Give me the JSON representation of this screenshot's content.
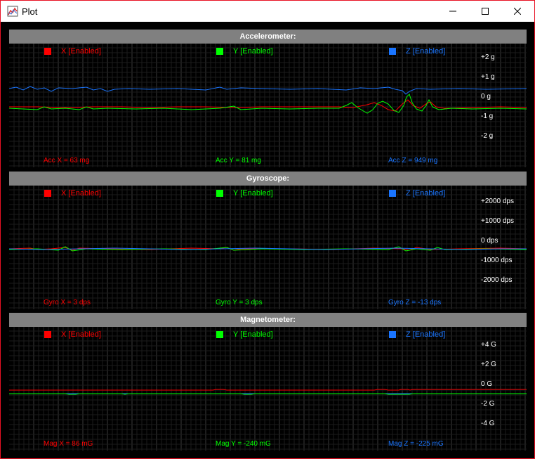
{
  "window": {
    "title": "Plot",
    "app_icon": "chart-icon",
    "border_color": "#e81123",
    "controls": {
      "minimize": "minimize-icon",
      "maximize": "maximize-icon",
      "close": "close-icon"
    }
  },
  "colors": {
    "x": "#ff0000",
    "y": "#00ff00",
    "z": "#1a75ff",
    "header_bg": "#808080"
  },
  "panels": [
    {
      "title": "Accelerometer:",
      "legend": {
        "x": "X [Enabled]",
        "y": "Y [Enabled]",
        "z": "Z [Enabled]"
      },
      "y_ticks": [
        "+2 g",
        "+1 g",
        "0 g",
        "-1 g",
        "-2 g"
      ],
      "readouts": {
        "x": "Acc X = 63 mg",
        "y": "Acc Y = 81 mg",
        "z": "Acc Z = 949 mg"
      }
    },
    {
      "title": "Gyroscope:",
      "legend": {
        "x": "X [Enabled]",
        "y": "Y [Enabled]",
        "z": "Z [Enabled]"
      },
      "y_ticks": [
        "+2000 dps",
        "+1000 dps",
        "0 dps",
        "-1000 dps",
        "-2000 dps"
      ],
      "readouts": {
        "x": "Gyro X = 3 dps",
        "y": "Gyro Y = 3 dps",
        "z": "Gyro Z = -13 dps"
      }
    },
    {
      "title": "Magnetometer:",
      "legend": {
        "x": "X [Enabled]",
        "y": "Y [Enabled]",
        "z": "Z [Enabled]"
      },
      "y_ticks": [
        "+4 G",
        "+2 G",
        "0 G",
        "-2 G",
        "-4 G"
      ],
      "readouts": {
        "x": "Mag X = 86 mG",
        "y": "Mag Y = -240 mG",
        "z": "Mag Z = -225 mG"
      }
    }
  ]
}
